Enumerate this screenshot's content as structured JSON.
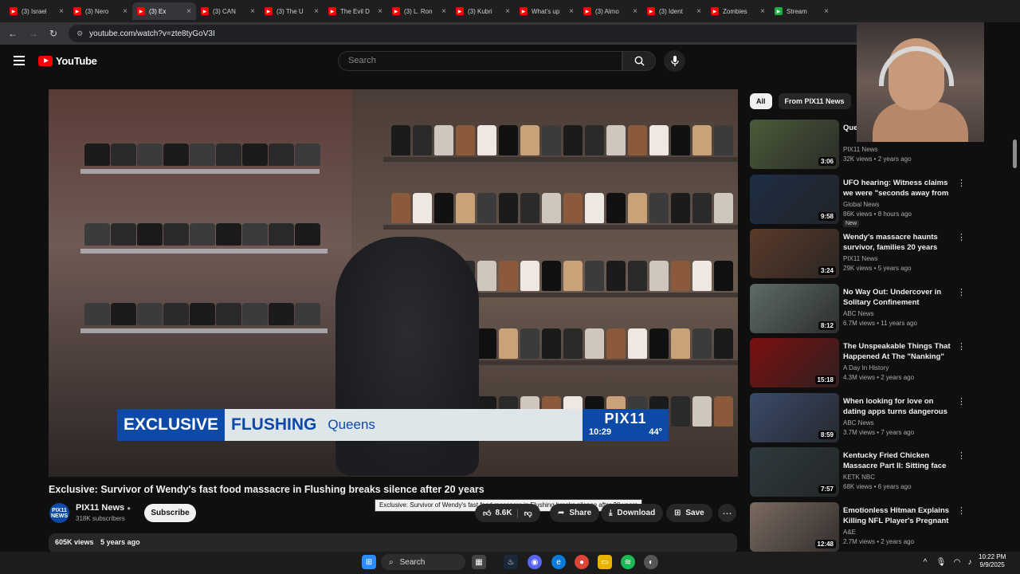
{
  "browser": {
    "tabs": [
      {
        "label": "(3) Israel",
        "fav_color": "#ff0000"
      },
      {
        "label": "(3) Nero",
        "fav_color": "#ff0000"
      },
      {
        "label": "(3) Ex",
        "fav_color": "#ff0000",
        "active": true
      },
      {
        "label": "(3) CAN",
        "fav_color": "#ff0000"
      },
      {
        "label": "(3) The U",
        "fav_color": "#ff0000"
      },
      {
        "label": "The Evil D",
        "fav_color": "#ff0000"
      },
      {
        "label": "(3) L. Ron",
        "fav_color": "#ff0000"
      },
      {
        "label": "(3) Kubri",
        "fav_color": "#ff0000"
      },
      {
        "label": "What's up",
        "fav_color": "#ff0000"
      },
      {
        "label": "(3) Almo",
        "fav_color": "#ff0000"
      },
      {
        "label": "(3) Ident",
        "fav_color": "#ff0000"
      },
      {
        "label": "Zombies",
        "fav_color": "#ff0000"
      },
      {
        "label": "Stream",
        "fav_color": "#22aa44"
      }
    ],
    "url": "youtube.com/watch?v=zte8tyGoV3I"
  },
  "header": {
    "logo_text": "YouTube",
    "search_placeholder": "Search"
  },
  "video": {
    "banner_exclusive": "EXCLUSIVE",
    "banner_location": "FLUSHING",
    "banner_borough": "Queens",
    "station_logo": "PIX11",
    "station_time": "10:29",
    "station_temp": "44°",
    "title": "Exclusive: Survivor of Wendy's fast food massacre in Flushing breaks silence after 20 years",
    "tooltip": "Exclusive: Survivor of Wendy's fast food massacre in Flushing breaks silence after 20 years"
  },
  "channel": {
    "avatar_text": "PIX11 NEWS",
    "name": "PIX11 News",
    "subscribers": "318K subscribers",
    "subscribe_label": "Subscribe"
  },
  "actions": {
    "likes": "8.6K",
    "share": "Share",
    "download": "Download",
    "save": "Save"
  },
  "description": {
    "views": "605K views",
    "age": "5 years ago"
  },
  "sidebar": {
    "chips": [
      "All",
      "From PIX11 News"
    ],
    "recommendations": [
      {
        "title": "Que victi",
        "channel": "PIX11 News",
        "meta": "32K views • 2 years ago",
        "duration": "3:06",
        "thumb_color": "#4b5b3a"
      },
      {
        "title": "UFO hearing: Witness claims we were \"seconds away from ...",
        "channel": "Global News",
        "meta": "86K views • 8 hours ago",
        "duration": "9:58",
        "thumb_color": "#1e2d44",
        "badge": "New"
      },
      {
        "title": "Wendy's massacre haunts survivor, families 20 years later",
        "channel": "PIX11 News",
        "meta": "29K views • 5 years ago",
        "duration": "3:24",
        "thumb_color": "#5a3a2a"
      },
      {
        "title": "No Way Out: Undercover in Solitary Confinement",
        "channel": "ABC News",
        "meta": "6.7M views • 11 years ago",
        "duration": "8:12",
        "thumb_color": "#5d6b66"
      },
      {
        "title": "The Unspeakable Things That Happened At The \"Nanking\" ...",
        "channel": "A Day In History",
        "meta": "4.3M views • 2 years ago",
        "duration": "15:18",
        "thumb_color": "#7a1010"
      },
      {
        "title": "When looking for love on dating apps turns dangerous",
        "channel": "ABC News",
        "meta": "3.7M views • 7 years ago",
        "duration": "8:59",
        "thumb_color": "#3a4a6a"
      },
      {
        "title": "Kentucky Fried Chicken Massacre Part II: Sitting face t...",
        "channel": "KETK NBC",
        "meta": "68K views • 6 years ago",
        "duration": "7:57",
        "thumb_color": "#2e3a3e"
      },
      {
        "title": "Emotionless Hitman Explains Killing NFL Player's Pregnant ...",
        "channel": "A&E",
        "meta": "2.7M views • 2 years ago",
        "duration": "12:48",
        "thumb_color": "#7b6a60"
      }
    ]
  },
  "taskbar": {
    "search_label": "Search",
    "time": "10:22 PM",
    "date": "9/9/2025"
  }
}
